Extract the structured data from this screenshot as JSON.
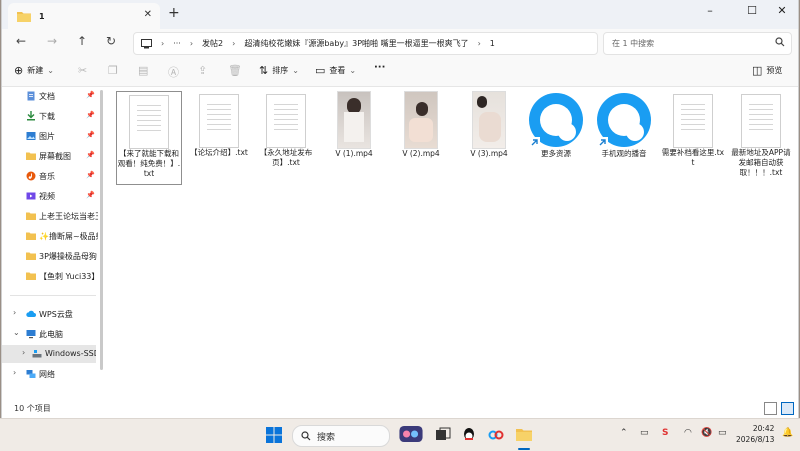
{
  "window": {
    "tab_title": "1",
    "new_tab": "+",
    "controls": {
      "minimize": "–",
      "maximize": "☐",
      "close": "✕"
    }
  },
  "address": {
    "more": "···",
    "crumbs": [
      "发帖2",
      "超清纯校花嫩妹『源源baby』3P啪啪 嘴里一根逼里一根爽飞了",
      "1"
    ],
    "search_placeholder": "在 1 中搜索"
  },
  "toolbar": {
    "new_label": "新建",
    "sort_label": "排序",
    "view_label": "查看",
    "more_label": "···",
    "preview_label": "预览"
  },
  "sidebar": {
    "quick": [
      {
        "label": "文档",
        "icon": "documents-icon",
        "pinned": true
      },
      {
        "label": "下载",
        "icon": "download-icon",
        "pinned": true
      },
      {
        "label": "图片",
        "icon": "pictures-icon",
        "pinned": true
      },
      {
        "label": "屏幕截图",
        "icon": "folder-icon",
        "pinned": true
      },
      {
        "label": "音乐",
        "icon": "music-icon",
        "pinned": true
      },
      {
        "label": "视频",
        "icon": "videos-icon",
        "pinned": true
      },
      {
        "label": "上老王论坛当老王",
        "icon": "folder-icon",
        "pinned": false
      },
      {
        "label": "✨撸断屌~极品射",
        "icon": "folder-icon",
        "pinned": false
      },
      {
        "label": "3P爆操极品母狗",
        "icon": "folder-icon",
        "pinned": false
      },
      {
        "label": "【鱼刺 Yuci33】",
        "icon": "folder-icon",
        "pinned": false
      }
    ],
    "wps": "WPS云盘",
    "this_pc": "此电脑",
    "drive": "Windows-SSD",
    "network": "网络"
  },
  "files": [
    {
      "name": "【来了就能下载和观看！纯免费！】.txt",
      "type": "txt",
      "selected": true
    },
    {
      "name": "【论坛介绍】.txt",
      "type": "txt",
      "selected": false
    },
    {
      "name": "【永久地址发布页】.txt",
      "type": "txt",
      "selected": false
    },
    {
      "name": "V (1).mp4",
      "type": "video",
      "selected": false
    },
    {
      "name": "V (2).mp4",
      "type": "video",
      "selected": false
    },
    {
      "name": "V (3).mp4",
      "type": "video",
      "selected": false
    },
    {
      "name": "更多资源",
      "type": "shortcut",
      "selected": false
    },
    {
      "name": "手机观的播音",
      "type": "shortcut",
      "selected": false
    },
    {
      "name": "需要补档看这里.txt",
      "type": "txt",
      "selected": false
    },
    {
      "name": "最新地址及APP请发邮箱自动获取！！！.txt",
      "type": "txt",
      "selected": false
    }
  ],
  "status": {
    "count": "10 个项目"
  },
  "taskbar": {
    "search_label": "搜索",
    "time": "20:42",
    "date": "2026/8/13"
  },
  "colors": {
    "accent": "#0067c0",
    "folder": "#f2c150",
    "qq_blue": "#1a9df2"
  }
}
